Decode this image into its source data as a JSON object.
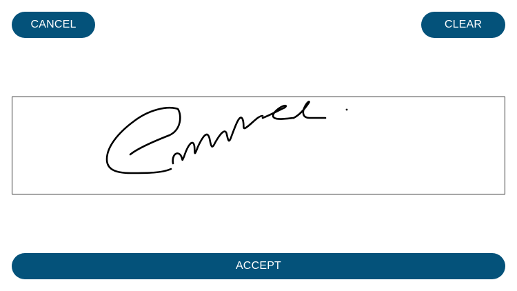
{
  "toolbar": {
    "cancel_label": "CANCEL",
    "clear_label": "CLEAR"
  },
  "footer": {
    "accept_label": "ACCEPT"
  },
  "signature_pad": {
    "has_signature": true,
    "stroke_color": "#000000"
  },
  "colors": {
    "button_background": "#04527a",
    "button_text": "#ffffff",
    "pad_border": "#333333"
  }
}
